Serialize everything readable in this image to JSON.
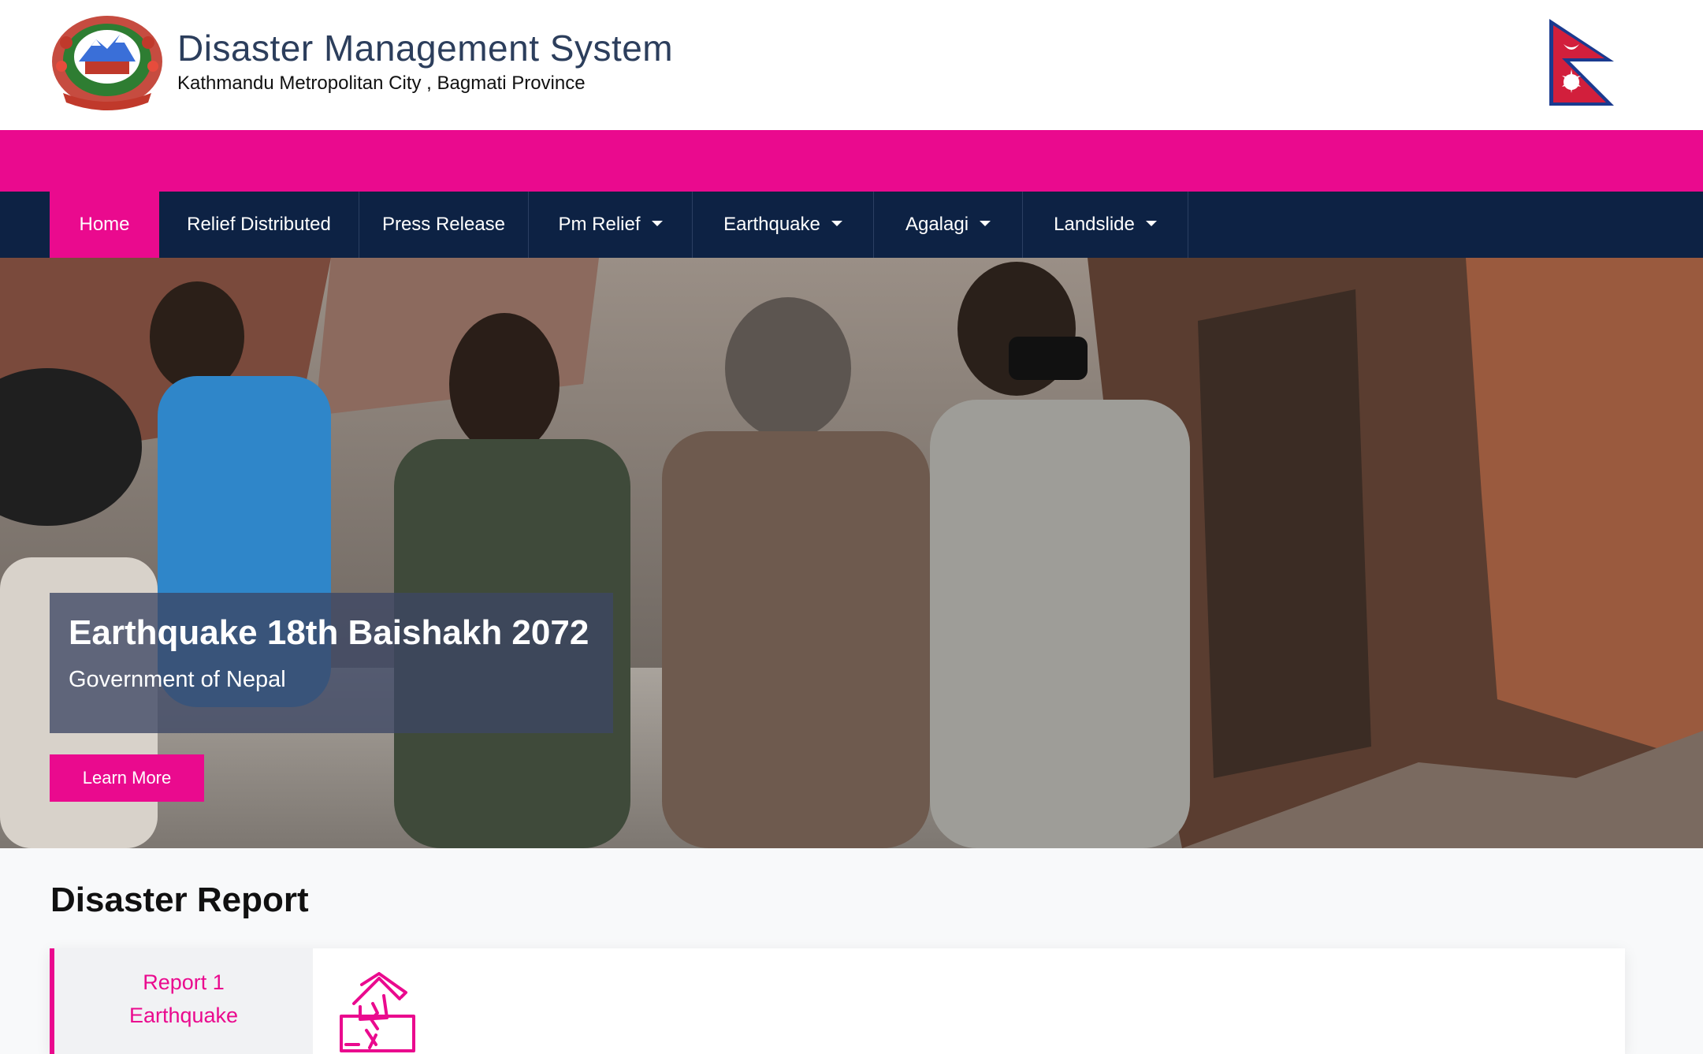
{
  "header": {
    "title": "Disaster Management System",
    "subtitle": "Kathmandu Metropolitan City , Bagmati Province",
    "emblem_icon": "nepal-emblem-icon",
    "flag_icon": "nepal-flag-icon"
  },
  "nav": {
    "items": [
      {
        "label": "Home",
        "active": true,
        "dropdown": false
      },
      {
        "label": "Relief Distributed",
        "active": false,
        "dropdown": false
      },
      {
        "label": "Press Release",
        "active": false,
        "dropdown": false
      },
      {
        "label": "Pm Relief",
        "active": false,
        "dropdown": true
      },
      {
        "label": "Earthquake",
        "active": false,
        "dropdown": true
      },
      {
        "label": "Agalagi",
        "active": false,
        "dropdown": true
      },
      {
        "label": "Landslide",
        "active": false,
        "dropdown": true
      }
    ]
  },
  "hero": {
    "title": "Earthquake 18th Baishakh 2072",
    "subtitle": "Government of Nepal",
    "button_label": "Learn More"
  },
  "report_section": {
    "title": "Disaster Report",
    "tab_line1": "Report 1",
    "tab_line2": "Earthquake",
    "icon": "collapsed-house-icon"
  },
  "colors": {
    "accent": "#ea0a8e",
    "nav_bg": "#0d2244",
    "title_text": "#2c3e5c"
  }
}
